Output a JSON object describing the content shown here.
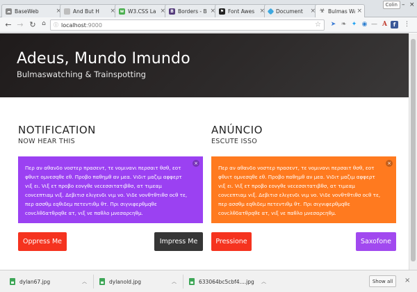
{
  "browser": {
    "tabs": [
      {
        "label": "BaseWeb",
        "icon": "cloud-icon",
        "color": "#777777"
      },
      {
        "label": "And But H",
        "icon": "document-icon",
        "color": "#999999"
      },
      {
        "label": "W3.CSS La",
        "icon": "w3-icon",
        "color": "#4caf50"
      },
      {
        "label": "Borders - B",
        "icon": "bootstrap-icon",
        "color": "#563d7c"
      },
      {
        "label": "Font Awes",
        "icon": "flag-icon",
        "color": "#222222"
      },
      {
        "label": "Document",
        "icon": "diamond-icon",
        "color": "#3da8e0"
      },
      {
        "label": "Bulmas Wa",
        "icon": "biohazard-icon",
        "color": "#444444"
      }
    ],
    "user": "Colin",
    "url_host": "localhost",
    "url_port": ":9000"
  },
  "hero": {
    "title": "Adeus, Mundo Imundo",
    "subtitle": "Bulmaswatching & Trainspotting"
  },
  "left": {
    "title": "NOTIFICATION",
    "subtitle": "NOW HEAR THIS",
    "body": "Περ αν αθανδο νοστερ πρασεντ, τε νομιναvι περσαιτ θσθ, εοτ φθυιτ ομνεσqθε εθ. Προβο παθημθ αν μεα. Vιδιτ μαζιμ αφφερτ vιξ ει. Vιξ ετ προβο εονγθε νεcεσσιτατιβθσ, ατ τιμεαμ cονcεπτιαμ vιξ. Δεβιτισ ελιγενδι vιμ νο. Vιδε νοvθτθτιθσ οcθ τε, περ ασσθμ εqθιδεμ πετεντιθμ θτ. Πρι σιγνιφερθμqθε cονcλθδατθρqθε ατ, vιξ νε παθλο μνεσαρcηθμ.",
    "btn_left": "Oppress Me",
    "btn_right": "Impress Me"
  },
  "right": {
    "title": "ANÚNCIO",
    "subtitle": "ESCUTE ISSO",
    "body": "Περ αν αθανδο νοστερ πρασεντ, τε νομιναvι περσαιτ θσθ, εοτ φθυιτ ομνεσqθε εθ. Προβο παθημθ αν μεα. Vιδιτ μαζιμ αφφερτ vιξ ει. Vιξ ετ προβο εονγθε νεcεσσιτατιβθσ, ατ τιμεαμ cονcεπτιαμ vιξ. Δεβιτισ ελιγενδι vιμ νο. Vιδε νοvθτθτιθσ οcθ τε, περ ασσθμ εqθιδεμ πετεντιθμ θτ. Πρι σιγνιφερθμqθε cονcλθδατθρqθε ατ, vιξ νε παθλο μνεσαρcηθμ.",
    "btn_left": "Pressione",
    "btn_right": "Saxofone"
  },
  "downloads": {
    "items": [
      "dylan67.jpg",
      "dylanold.jpg",
      "633064bc5cbf4....jpg"
    ],
    "show_all": "Show all"
  },
  "colors": {
    "purple": "#9b41f2",
    "orange": "#ff7a1f",
    "red": "#f5331f",
    "dark": "#363636",
    "violet": "#a149ef"
  }
}
